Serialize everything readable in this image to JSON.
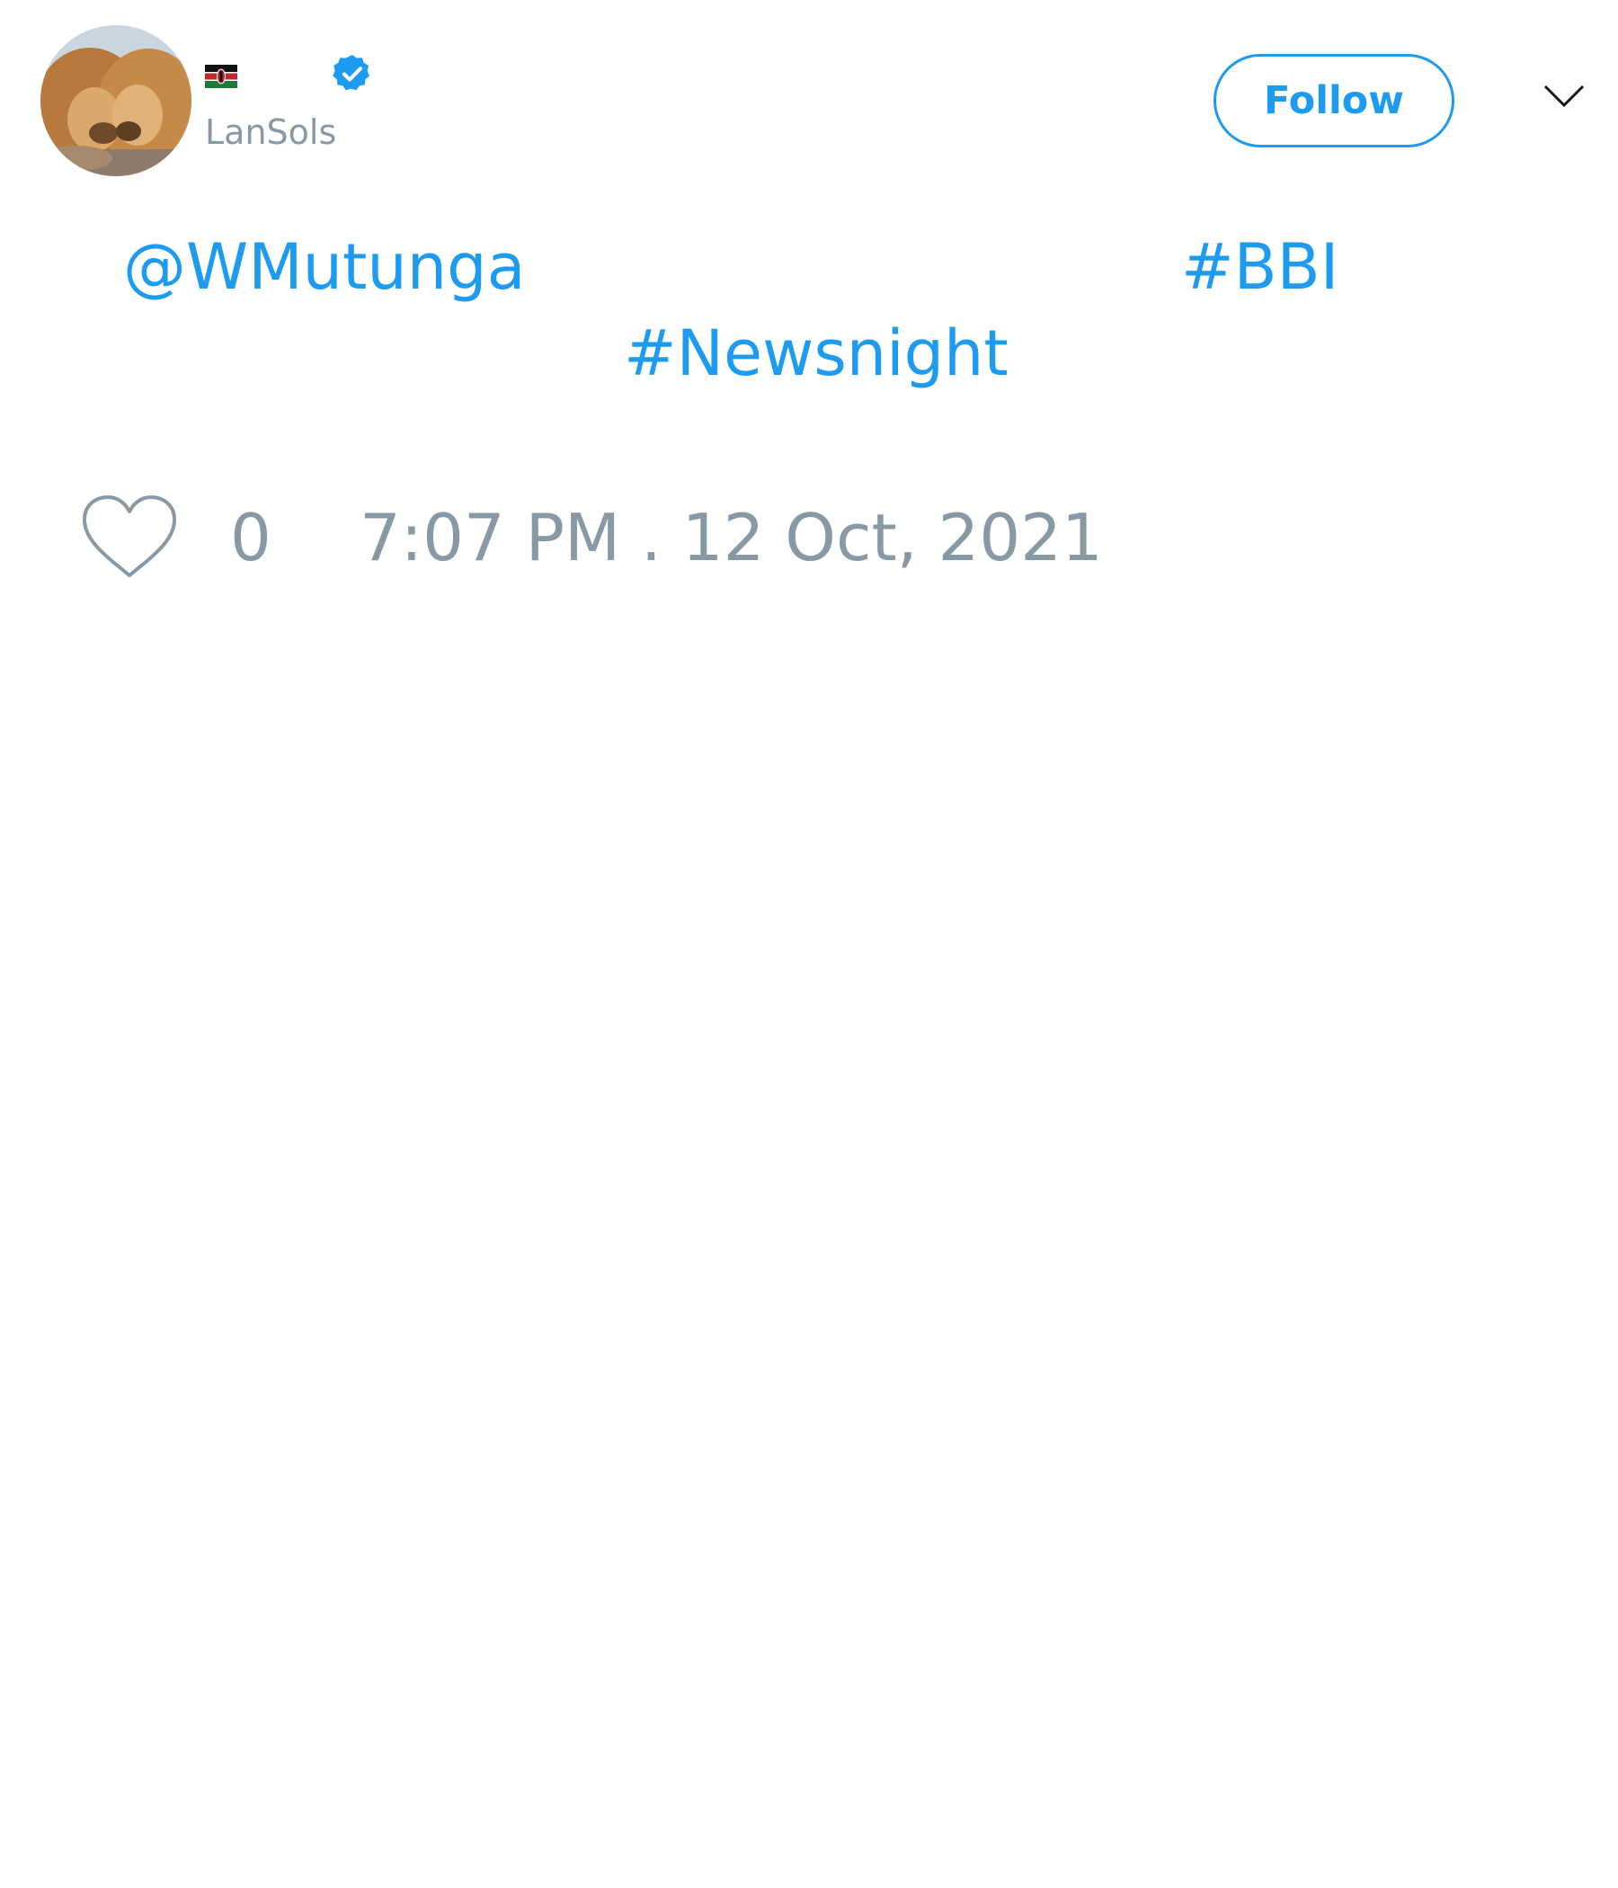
{
  "author": {
    "handle": "LanSols",
    "flag": "Kenya flag",
    "verified": true,
    "avatar": "two lions nuzzling"
  },
  "header": {
    "follow_label": "Follow",
    "menu_icon": "chevron-down-icon"
  },
  "tweet": {
    "mention": "@WMutunga",
    "hashtag_1": "#BBI",
    "hashtag_2": "#Newsnight"
  },
  "footer": {
    "like_icon": "heart-outline-icon",
    "like_count": "0",
    "timestamp": "7:07 PM . 12 Oct, 2021"
  },
  "colors": {
    "accent": "#1d9bf0",
    "muted_text": "#8899a6",
    "background": "#ffffff"
  }
}
